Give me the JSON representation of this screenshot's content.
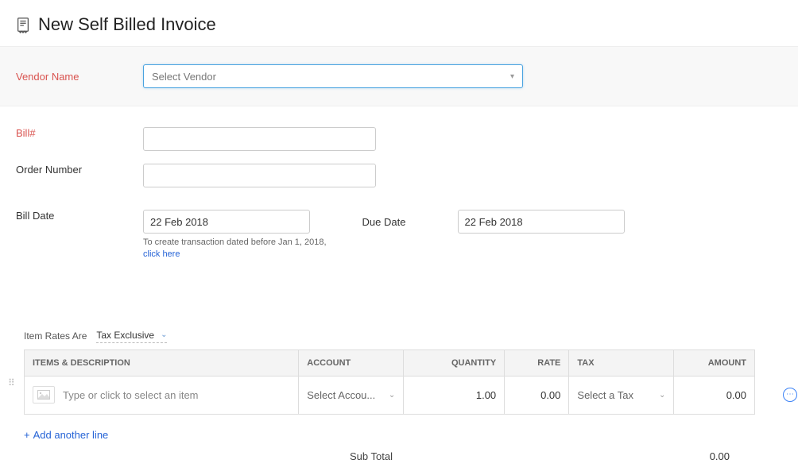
{
  "header": {
    "title": "New Self Billed Invoice"
  },
  "vendor": {
    "label": "Vendor Name",
    "placeholder": "Select Vendor"
  },
  "bill_number": {
    "label": "Bill#",
    "value": ""
  },
  "order_number": {
    "label": "Order Number",
    "value": ""
  },
  "bill_date": {
    "label": "Bill Date",
    "value": "22 Feb 2018",
    "helper_prefix": "To create transaction dated before Jan 1, 2018,",
    "helper_link": "click here"
  },
  "due_date": {
    "label": "Due Date",
    "value": "22 Feb 2018"
  },
  "rates": {
    "label": "Item Rates Are",
    "value": "Tax Exclusive"
  },
  "table": {
    "headers": {
      "items": "ITEMS & DESCRIPTION",
      "account": "ACCOUNT",
      "quantity": "QUANTITY",
      "rate": "RATE",
      "tax": "TAX",
      "amount": "AMOUNT"
    },
    "row": {
      "item_placeholder": "Type or click to select an item",
      "account_placeholder": "Select Accou...",
      "quantity": "1.00",
      "rate": "0.00",
      "tax_placeholder": "Select a Tax",
      "amount": "0.00"
    }
  },
  "add_line": {
    "label": "Add another line"
  },
  "subtotal": {
    "label": "Sub Total",
    "value": "0.00"
  }
}
